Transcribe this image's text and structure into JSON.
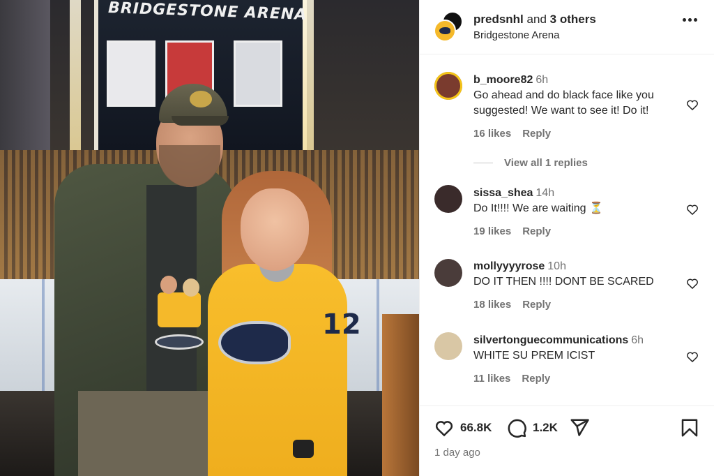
{
  "photo": {
    "arena_sign": "BRIDGESTONE ARENA",
    "jersey_number": "12"
  },
  "post": {
    "author": "predsnhl",
    "collab_text": "and",
    "collab_count": "3 others",
    "location": "Bridgestone Arena",
    "time_ago": "1 day ago",
    "likes": "66.8K",
    "comments_count": "1.2K"
  },
  "comments": [
    {
      "username": "b_moore82",
      "time": "6h",
      "text": "Go ahead and do black face like you suggested! We want to see it! Do it!",
      "likes": "16 likes",
      "reply": "Reply",
      "view_replies": "View all 1 replies",
      "avatar_color": "#7a3b2e"
    },
    {
      "username": "sissa_shea",
      "time": "14h",
      "text": "Do It!!!! We are waiting ⏳",
      "likes": "19 likes",
      "reply": "Reply",
      "avatar_color": "#3a2b2b"
    },
    {
      "username": "mollyyyyrose",
      "time": "10h",
      "text": "DO IT THEN !!!! DONT BE SCARED",
      "likes": "18 likes",
      "reply": "Reply",
      "avatar_color": "#4a3c3a"
    },
    {
      "username": "silvertonguecommunications",
      "time": "6h",
      "text": "WHITE SU PREM ICIST",
      "likes": "11 likes",
      "reply": "Reply",
      "avatar_color": "#d9c7a5"
    }
  ],
  "icons": {
    "like": "heart-icon",
    "comment": "comment-icon",
    "share": "send-icon",
    "save": "bookmark-icon",
    "more": "more-options-icon"
  }
}
